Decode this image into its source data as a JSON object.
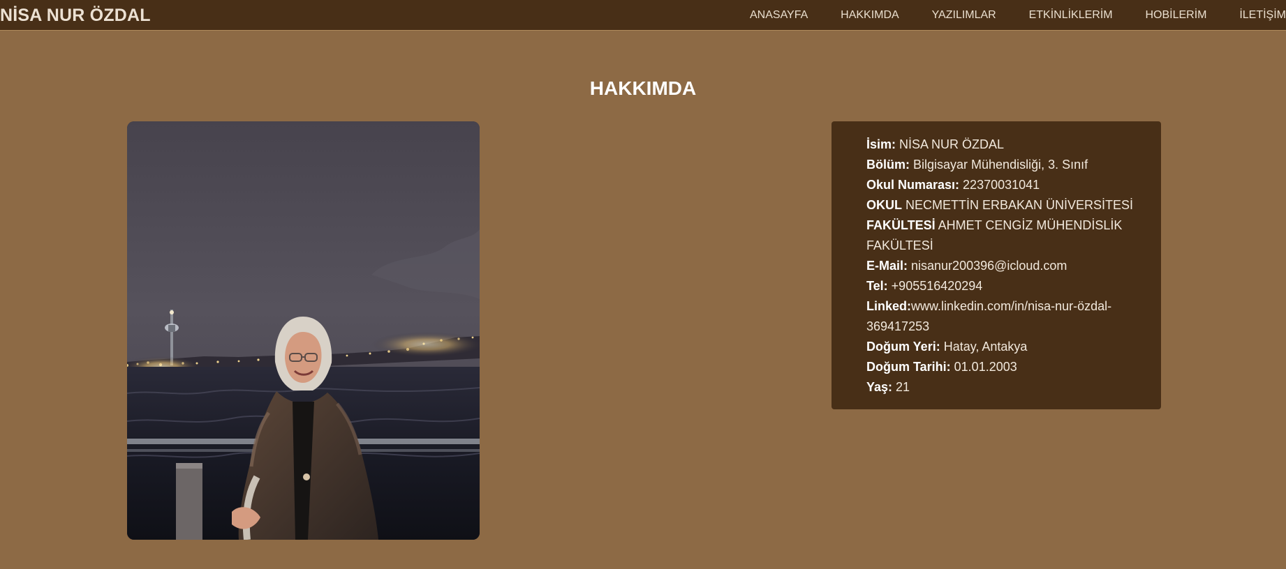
{
  "header": {
    "brand": "NİSA NUR ÖZDAL",
    "nav": [
      "ANASAYFA",
      "HAKKIMDA",
      "YAZILIMLAR",
      "ETKİNLİKLERİM",
      "HOBİLERİM",
      "İLETİŞİM"
    ]
  },
  "page": {
    "title": "HAKKIMDA"
  },
  "profile": {
    "items": [
      {
        "label": "İsim:",
        "value": " NİSA NUR ÖZDAL"
      },
      {
        "label": "Bölüm:",
        "value": " Bilgisayar Mühendisliği, 3. Sınıf"
      },
      {
        "label": "Okul Numarası:",
        "value": " 22370031041"
      },
      {
        "label": "OKUL",
        "value": " NECMETTİN ERBAKAN ÜNİVERSİTESİ"
      },
      {
        "label": "FAKÜLTESİ",
        "value": " AHMET CENGİZ MÜHENDİSLİK FAKÜLTESİ"
      },
      {
        "label": "E-Mail:",
        "value": " nisanur200396@icloud.com"
      },
      {
        "label": "Tel:",
        "value": " +905516420294"
      },
      {
        "label": "Linked:",
        "value": "www.linkedin.com/in/nisa-nur-özdal-369417253"
      },
      {
        "label": "Doğum Yeri:",
        "value": " Hatay, Antakya"
      },
      {
        "label": "Doğum Tarihi:",
        "value": " 01.01.2003"
      },
      {
        "label": "Yaş:",
        "value": " 21"
      }
    ]
  },
  "colors": {
    "background": "#8d6a45",
    "navbar": "#482f17",
    "card": "#482f17",
    "text": "#ffffff"
  }
}
